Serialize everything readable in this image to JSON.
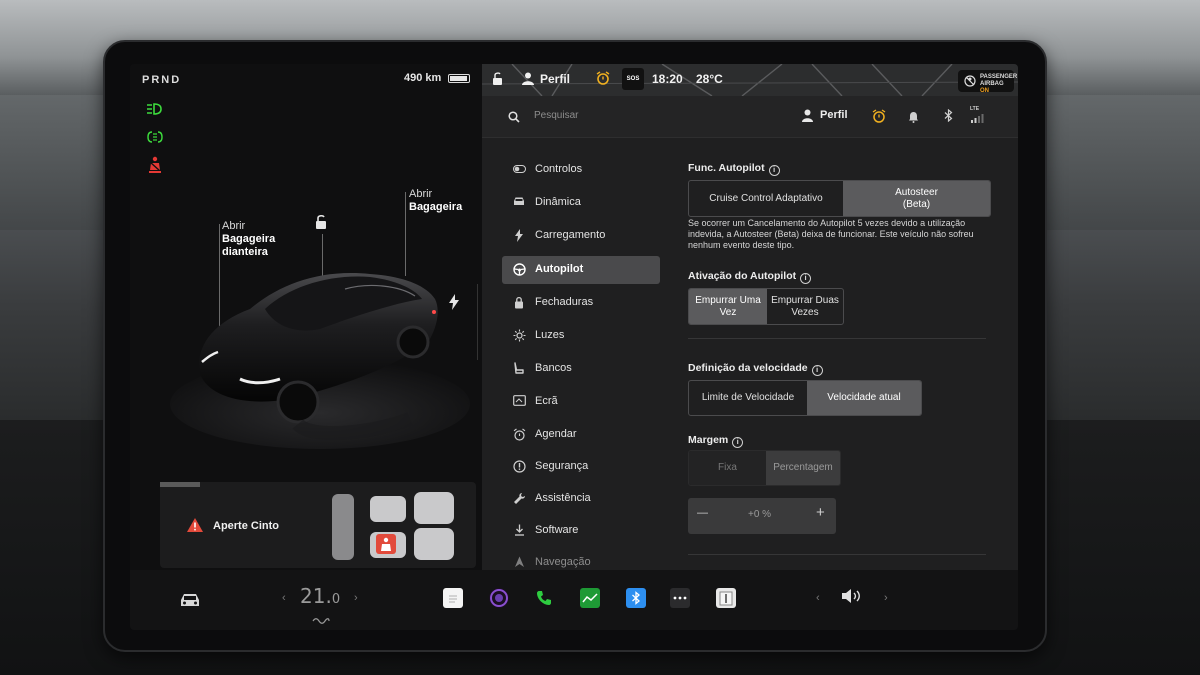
{
  "left_panel": {
    "gear_selector": "PRND",
    "range": "490 km",
    "callouts": {
      "front_trunk": {
        "line1": "Abrir",
        "line2": "Bagageira",
        "line3": "dianteira"
      },
      "rear_trunk": {
        "line1": "Abrir",
        "line2": "Bagageira"
      }
    },
    "alert": {
      "text": "Aperte Cinto"
    }
  },
  "status_bar": {
    "profile": "Perfil",
    "sos": "SOS",
    "time": "18:20",
    "temperature": "28°C",
    "airbag_line1": "PASSENGER",
    "airbag_line2": "AIRBAG",
    "airbag_state": "ON"
  },
  "top_bar": {
    "search_placeholder": "Pesquisar",
    "profile": "Perfil",
    "network": "LTE"
  },
  "menu": {
    "items": [
      {
        "label": "Controlos",
        "icon": "toggle-icon"
      },
      {
        "label": "Dinâmica",
        "icon": "car-icon"
      },
      {
        "label": "Carregamento",
        "icon": "bolt-icon"
      },
      {
        "label": "Autopilot",
        "icon": "steering-wheel-icon",
        "active": true
      },
      {
        "label": "Fechaduras",
        "icon": "lock-icon"
      },
      {
        "label": "Luzes",
        "icon": "sun-icon"
      },
      {
        "label": "Bancos",
        "icon": "seat-icon"
      },
      {
        "label": "Ecrã",
        "icon": "display-icon"
      },
      {
        "label": "Agendar",
        "icon": "alarm-icon"
      },
      {
        "label": "Segurança",
        "icon": "safety-icon"
      },
      {
        "label": "Assistência",
        "icon": "wrench-icon"
      },
      {
        "label": "Software",
        "icon": "download-icon"
      },
      {
        "label": "Navegação",
        "icon": "navigation-icon"
      }
    ]
  },
  "autopilot": {
    "func_title": "Func. Autopilot",
    "func_options": [
      "Cruise Control Adaptativo",
      "Autosteer\n(Beta)"
    ],
    "func_selected": 1,
    "note": "Se ocorrer um Cancelamento do Autopilot 5 vezes devido a utilização indevida, a Autosteer (Beta) deixa de funcionar. Este veículo não sofreu nenhum evento deste tipo.",
    "activation_title": "Ativação do Autopilot",
    "activation_options": [
      "Empurrar Uma Vez",
      "Empurrar Duas Vezes"
    ],
    "activation_selected": 0,
    "speed_title": "Definição da velocidade",
    "speed_options": [
      "Limite de Velocidade",
      "Velocidade atual"
    ],
    "speed_selected": 1,
    "margin_title": "Margem",
    "margin_options": [
      "Fixa",
      "Percentagem"
    ],
    "margin_selected": 1,
    "offset_value": "+0 %",
    "offset_minus": "—",
    "offset_plus": "+"
  },
  "dock": {
    "temperature": "21.",
    "temperature_decimal": "0",
    "left_arrow": "‹",
    "right_arrow": "›",
    "volume_left_arrow": "‹",
    "volume_right_arrow": "›"
  }
}
